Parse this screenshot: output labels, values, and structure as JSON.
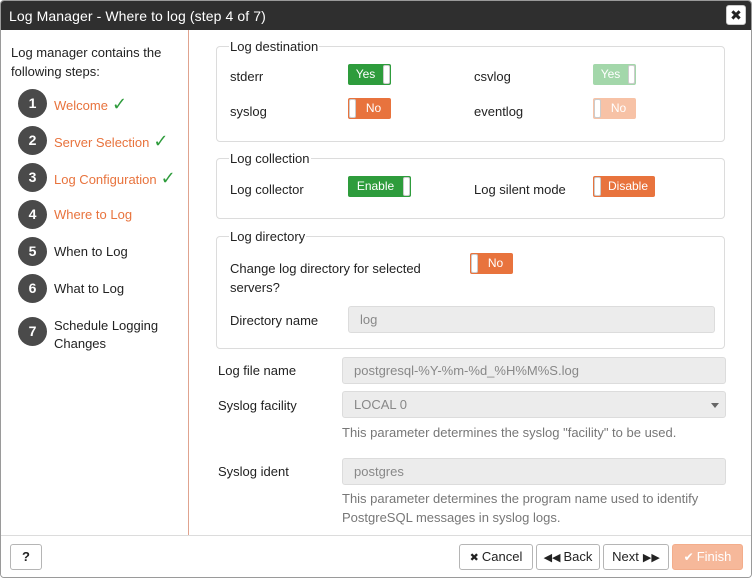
{
  "window": {
    "title": "Log Manager - Where to log (step 4 of 7)",
    "close_label": "✖"
  },
  "sidebar": {
    "intro": "Log manager contains the following steps:",
    "steps": [
      {
        "num": "1",
        "label": "Welcome",
        "check": "✓"
      },
      {
        "num": "2",
        "label": "Server Selection",
        "check": "✓"
      },
      {
        "num": "3",
        "label": "Log Configuration",
        "check": "✓"
      },
      {
        "num": "4",
        "label": "Where to Log"
      },
      {
        "num": "5",
        "label": "When to Log"
      },
      {
        "num": "6",
        "label": "What to Log"
      },
      {
        "num": "7",
        "label": "Schedule Logging Changes"
      }
    ]
  },
  "log_destination": {
    "title": "Log destination",
    "stderr_label": "stderr",
    "stderr_value": "Yes",
    "csvlog_label": "csvlog",
    "csvlog_value": "Yes",
    "syslog_label": "syslog",
    "syslog_value": "No",
    "eventlog_label": "eventlog",
    "eventlog_value": "No"
  },
  "log_collection": {
    "title": "Log collection",
    "collector_label": "Log collector",
    "collector_value": "Enable",
    "silent_label": "Log silent mode",
    "silent_value": "Disable"
  },
  "log_directory": {
    "title": "Log directory",
    "change_label": "Change log directory for selected servers?",
    "change_value": "No",
    "dirname_label": "Directory name",
    "dirname_value": "log"
  },
  "fields": {
    "file_name_label": "Log file name",
    "file_name_value": "postgresql-%Y-%m-%d_%H%M%S.log",
    "facility_label": "Syslog facility",
    "facility_value": "LOCAL 0",
    "facility_help": "This parameter determines the syslog \"facility\" to be used.",
    "ident_label": "Syslog ident",
    "ident_value": "postgres",
    "ident_help": "This parameter determines the program name used to identify PostgreSQL messages in syslog logs."
  },
  "footer": {
    "help_label": "?",
    "cancel_label": "Cancel",
    "back_label": "Back",
    "next_label": "Next",
    "finish_label": "Finish"
  },
  "colors": {
    "accent": "#e8733d",
    "success": "#2e9c3c",
    "titlebar": "#2f2f2f"
  },
  "icons": {
    "cancel": "times-icon",
    "back": "backward-icon",
    "next": "forward-icon",
    "finish": "check-icon",
    "close": "close-icon"
  }
}
